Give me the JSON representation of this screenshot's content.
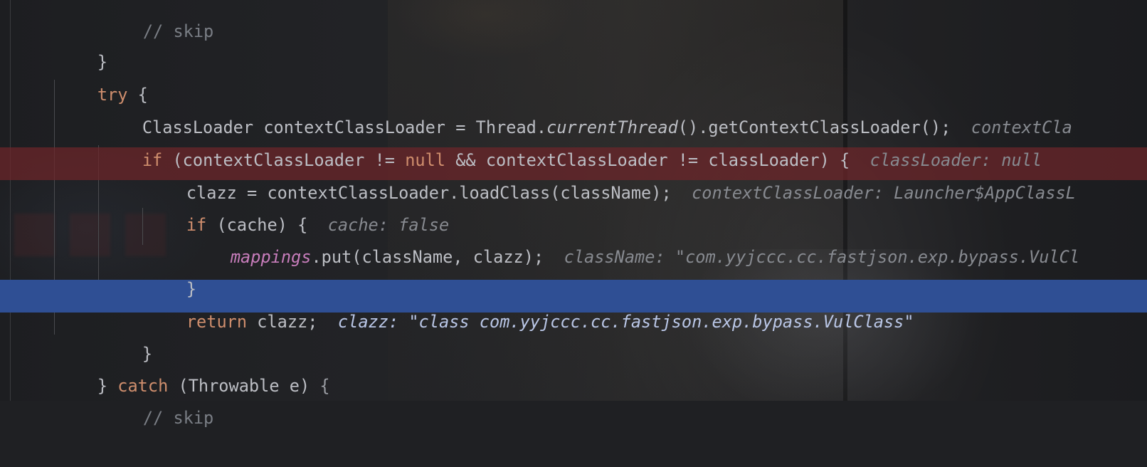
{
  "editor": {
    "lines": [
      {
        "comment": "// skip"
      },
      {
        "brace": "}"
      },
      {
        "keyword": "try",
        "brace": "{"
      },
      {
        "type": "ClassLoader",
        "var": "contextClassLoader",
        "eq": "=",
        "thread": "Thread",
        "dot": ".",
        "static_call": "currentThread",
        "call_rest": "().getContextClassLoader();",
        "hint": "contextCla"
      },
      {
        "keyword": "if",
        "open": "(contextClassLoader != ",
        "null_kw": "null",
        "rest": " && contextClassLoader != classLoader) {",
        "hint": "classLoader: null"
      },
      {
        "code": "clazz = contextClassLoader.loadClass(className);",
        "hint": "contextClassLoader: Launcher$AppClassL"
      },
      {
        "keyword": "if",
        "rest": " (cache) {",
        "hint": "cache: false"
      },
      {
        "field": "mappings",
        "rest": ".put(className, clazz);",
        "hint": "className: \"com.yyjccc.cc.fastjson.exp.bypass.VulCl"
      },
      {
        "brace": "}"
      },
      {
        "keyword": "return",
        "rest": " clazz;",
        "hint": "clazz: \"class com.yyjccc.cc.fastjson.exp.bypass.VulClass\""
      },
      {
        "brace": "}"
      },
      {
        "brace_open": "} ",
        "keyword": "catch",
        "rest": " (Throwable e) ",
        "brace": "{"
      },
      {
        "comment": "// skip"
      }
    ],
    "colors": {
      "background": "#1f2023",
      "keyword": "#cf8e6d",
      "text": "#bcbec4",
      "field": "#c77dbb",
      "comment": "#7a7e85",
      "inline_hint": "#878a90",
      "breakpoint_line": "#6e262a",
      "execution_line": "#2f4f94"
    }
  }
}
